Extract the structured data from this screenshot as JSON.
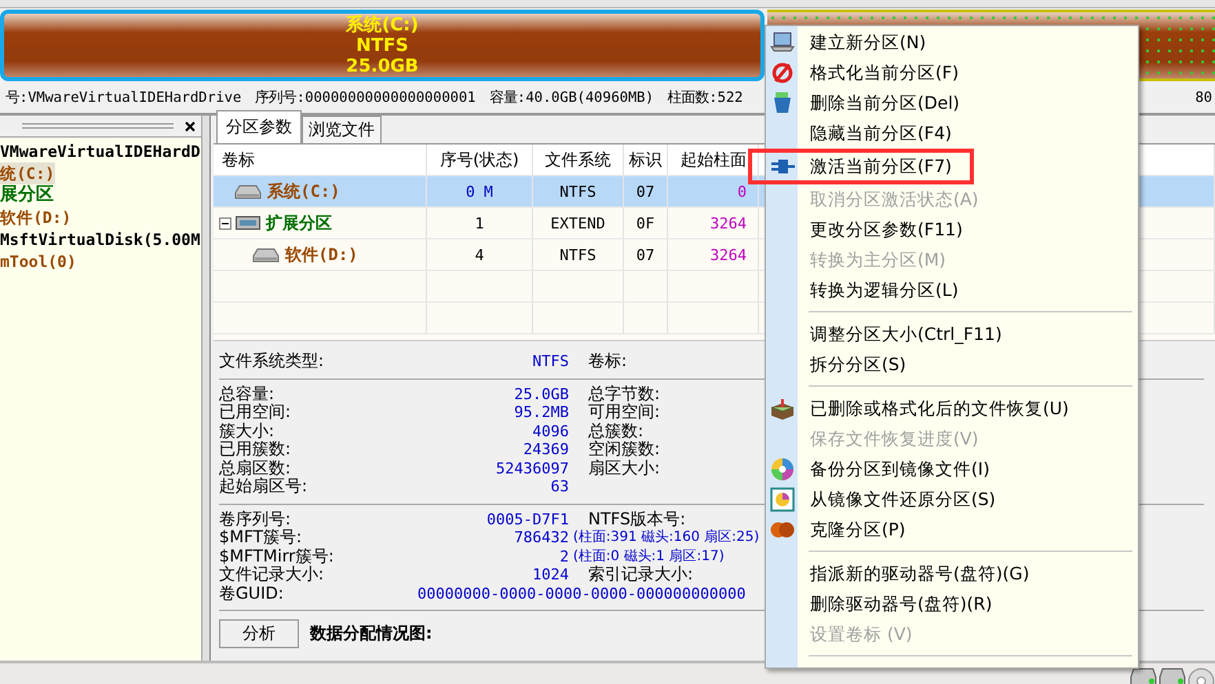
{
  "disk_map": {
    "segments": [
      {
        "kind": "primary",
        "selected": true,
        "lines": [
          "系统(C:)",
          "NTFS",
          "25.0GB"
        ]
      },
      {
        "kind": "logical",
        "selected": false
      }
    ]
  },
  "disk_info": [
    "号:VMwareVirtualIDEHardDrive",
    "序列号:00000000000000000001",
    "容量:40.0GB(40960MB)",
    "柱面数:522",
    "80"
  ],
  "tree": [
    {
      "label": "VMwareVirtualIDEHardD",
      "kind": "disk",
      "selected": false,
      "children": [
        {
          "label": "统(C:)",
          "kind": "partition",
          "selected": true
        },
        {
          "label": "展分区",
          "kind": "extended",
          "selected": false,
          "children": [
            {
              "label": "软件(D:)",
              "kind": "partition",
              "selected": false
            }
          ]
        }
      ]
    },
    {
      "label": "MsftVirtualDisk(5.00M",
      "kind": "disk",
      "selected": false,
      "children": [
        {
          "label": "mTool(0)",
          "kind": "partition",
          "selected": false
        }
      ]
    }
  ],
  "tabs": [
    {
      "label": "分区参数",
      "selected": true
    },
    {
      "label": "浏览文件",
      "selected": false
    }
  ],
  "table": {
    "columns": [
      "卷标",
      "序号(状态)",
      "文件系统",
      "标识",
      "起始柱面"
    ],
    "rows": [
      {
        "kind": "partition",
        "selected": true,
        "cells": [
          "系统(C:)",
          "0 M",
          "NTFS",
          "07",
          "0"
        ]
      },
      {
        "kind": "extended",
        "selected": false,
        "expanded": true,
        "cells": [
          "扩展分区",
          "1",
          "EXTEND",
          "0F",
          "3264"
        ],
        "children": [
          {
            "kind": "partition",
            "selected": false,
            "cells": [
              "软件(D:)",
              "4",
              "NTFS",
              "07",
              "3264"
            ]
          }
        ]
      }
    ]
  },
  "details": {
    "sections": [
      [
        {
          "label": "文件系统类型:",
          "value": "NTFS",
          "label2": "卷标:"
        }
      ],
      [
        {
          "label": "总容量:",
          "value": "25.0GB",
          "label2": "总字节数:"
        },
        {
          "label": "已用空间:",
          "value": "95.2MB",
          "label2": "可用空间:"
        },
        {
          "label": "簇大小:",
          "value": "4096",
          "label2": "总簇数:"
        },
        {
          "label": "已用簇数:",
          "value": "24369",
          "label2": "空闲簇数:"
        },
        {
          "label": "总扇区数:",
          "value": "52436097",
          "label2": "扇区大小:"
        },
        {
          "label": "起始扇区号:",
          "value": "63"
        }
      ],
      [
        {
          "label": "卷序列号:",
          "value": "0005-D7F1",
          "label2": "NTFS版本号:"
        },
        {
          "label": "$MFT簇号:",
          "value": "786432",
          "note": "(柱面:391 磁头:160 扇区:25)"
        },
        {
          "label": "$MFTMirr簇号:",
          "value": "2",
          "note": "(柱面:0 磁头:1 扇区:17)"
        },
        {
          "label": "文件记录大小:",
          "value": "1024",
          "label2": "索引记录大小:"
        },
        {
          "label": "卷GUID:",
          "value": "00000000-0000-0000-0000-000000000000",
          "kind": "wide"
        }
      ]
    ],
    "analyze_button": "分析",
    "allocation_label": "数据分配情况图:"
  },
  "context_menu": [
    {
      "kind": "item",
      "label": "建立新分区(N)",
      "disabled": false
    },
    {
      "kind": "item",
      "label": "格式化当前分区(F)",
      "disabled": false
    },
    {
      "kind": "item",
      "label": "删除当前分区(Del)",
      "disabled": false
    },
    {
      "kind": "item",
      "label": "隐藏当前分区(F4)",
      "disabled": false
    },
    {
      "kind": "item",
      "label": "激活当前分区(F7)",
      "disabled": false,
      "highlighted": true
    },
    {
      "kind": "item",
      "label": "取消分区激活状态(A)",
      "disabled": true
    },
    {
      "kind": "item",
      "label": "更改分区参数(F11)",
      "disabled": false
    },
    {
      "kind": "item",
      "label": "转换为主分区(M)",
      "disabled": true
    },
    {
      "kind": "item",
      "label": "转换为逻辑分区(L)",
      "disabled": false
    },
    {
      "kind": "separator"
    },
    {
      "kind": "item",
      "label": "调整分区大小(Ctrl_F11)",
      "disabled": false
    },
    {
      "kind": "item",
      "label": "拆分分区(S)",
      "disabled": false
    },
    {
      "kind": "separator"
    },
    {
      "kind": "item",
      "label": "已删除或格式化后的文件恢复(U)",
      "disabled": false
    },
    {
      "kind": "item",
      "label": "保存文件恢复进度(V)",
      "disabled": true
    },
    {
      "kind": "item",
      "label": "备份分区到镜像文件(I)",
      "disabled": false
    },
    {
      "kind": "item",
      "label": "从镜像文件还原分区(S)",
      "disabled": false
    },
    {
      "kind": "item",
      "label": "克隆分区(P)",
      "disabled": false
    },
    {
      "kind": "separator"
    },
    {
      "kind": "item",
      "label": "指派新的驱动器号(盘符)(G)",
      "disabled": false
    },
    {
      "kind": "item",
      "label": "删除驱动器号(盘符)(R)",
      "disabled": false
    },
    {
      "kind": "item",
      "label": "设置卷标 (V)",
      "disabled": true
    },
    {
      "kind": "separator"
    }
  ]
}
